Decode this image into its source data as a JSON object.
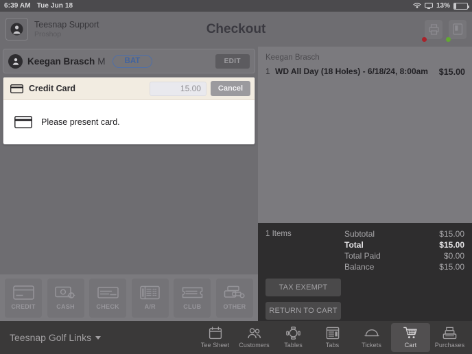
{
  "statusbar": {
    "time": "6:39 AM",
    "date": "Tue Jun 18",
    "battery_percent": "13%",
    "wifi_icon": "wifi-icon",
    "airplay_icon": "airplay-icon",
    "battery_icon": "battery-icon"
  },
  "header": {
    "brand_name": "Teesnap Support",
    "brand_sub": "Proshop",
    "title": "Checkout",
    "logo_icon": "user-circle-icon",
    "print_button": {
      "icon": "printer-icon",
      "status_color": "#a8232b"
    },
    "terminal_button": {
      "icon": "card-reader-icon",
      "status_color": "#62a832"
    }
  },
  "customer_bar": {
    "avatar_icon": "user-avatar-icon",
    "name": "Keegan Brasch",
    "initial": "M",
    "badge": "BAT",
    "badge_color": "#41639e",
    "edit_label": "EDIT"
  },
  "credit_card_panel": {
    "icon": "credit-card-icon",
    "title": "Credit Card",
    "amount_value": "15.00",
    "cancel_label": "Cancel",
    "body_icon": "credit-card-icon",
    "message": "Please present card.",
    "header_bg": "#f2ece1"
  },
  "payment_methods": [
    {
      "label": "CREDIT",
      "icon": "credit-card-icon"
    },
    {
      "label": "CASH",
      "icon": "cash-icon"
    },
    {
      "label": "CHECK",
      "icon": "check-icon"
    },
    {
      "label": "A/R",
      "icon": "ar-ledger-icon"
    },
    {
      "label": "CLUB",
      "icon": "club-ticket-icon"
    },
    {
      "label": "OTHER",
      "icon": "other-payment-icon"
    }
  ],
  "cart": {
    "customer": "Keegan Brasch",
    "items": [
      {
        "qty": "1",
        "description": "WD All Day (18 Holes) - 6/18/24, 8:00am",
        "price": "$15.00"
      }
    ],
    "items_count": "1 Items",
    "totals": [
      {
        "label": "Subtotal",
        "value": "$15.00",
        "bold": false
      },
      {
        "label": "Total",
        "value": "$15.00",
        "bold": true
      },
      {
        "label": "Total Paid",
        "value": "$0.00",
        "bold": false
      },
      {
        "label": "Balance",
        "value": "$15.00",
        "bold": false
      }
    ],
    "tax_exempt_label": "TAX EXEMPT",
    "return_to_cart_label": "RETURN TO CART"
  },
  "bottom_nav": {
    "course": "Teesnap Golf Links",
    "items": [
      {
        "label": "Tee Sheet",
        "icon": "calendar-icon",
        "active": false
      },
      {
        "label": "Customers",
        "icon": "people-icon",
        "active": false
      },
      {
        "label": "Tables",
        "icon": "table-icon",
        "active": false
      },
      {
        "label": "Tabs",
        "icon": "tabs-icon",
        "active": false
      },
      {
        "label": "Tickets",
        "icon": "ticket-dome-icon",
        "active": false
      },
      {
        "label": "Cart",
        "icon": "shopping-cart-icon",
        "active": true
      },
      {
        "label": "Purchases",
        "icon": "register-icon",
        "active": false
      }
    ]
  }
}
